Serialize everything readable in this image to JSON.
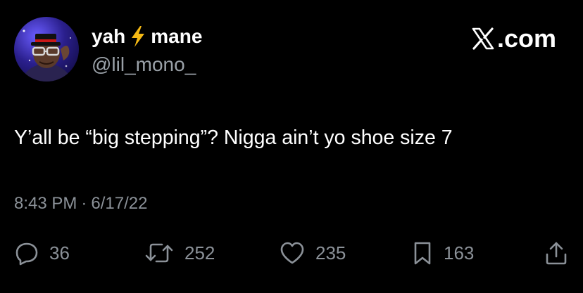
{
  "user": {
    "name_part1": "yah",
    "name_emoji_icon": "lightning-bolt-icon",
    "name_part2": "mane",
    "handle": "@lil_mono_"
  },
  "brand": {
    "logo_icon": "x-logo-icon",
    "text": ".com"
  },
  "tweet": {
    "text": "Y’all be “big stepping”? Nigga ain’t yo shoe size 7",
    "time": "8:43 PM",
    "separator": "·",
    "date": "6/17/22"
  },
  "actions": {
    "replies": {
      "icon": "reply-icon",
      "count": "36"
    },
    "retweets": {
      "icon": "retweet-icon",
      "count": "252"
    },
    "likes": {
      "icon": "heart-icon",
      "count": "235"
    },
    "bookmarks": {
      "icon": "bookmark-icon",
      "count": "163"
    },
    "share": {
      "icon": "share-icon"
    }
  },
  "colors": {
    "background": "#000000",
    "primary_text": "#ffffff",
    "secondary_text": "#8b9198",
    "bolt": "#f5b914"
  }
}
